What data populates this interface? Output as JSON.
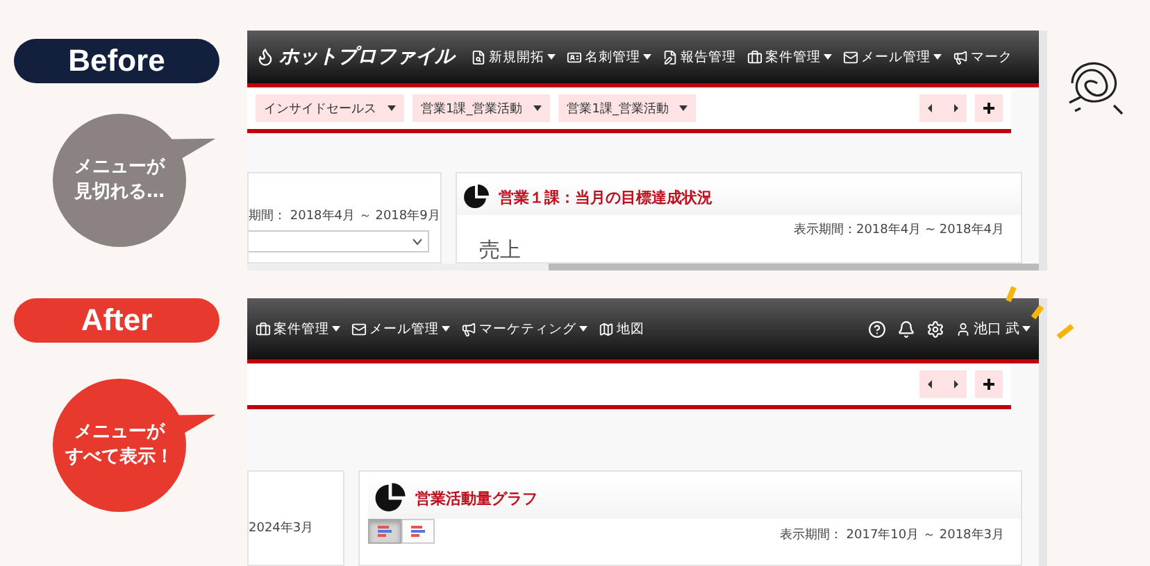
{
  "before": {
    "badge": "Before",
    "bubble": [
      "メニューが",
      "見切れる…"
    ],
    "navbar": {
      "logo": "ホットプロファイル",
      "menus": [
        {
          "label": "新規開拓",
          "dropdown": true
        },
        {
          "label": "名刺管理",
          "dropdown": true
        },
        {
          "label": "報告管理",
          "dropdown": false
        },
        {
          "label": "案件管理",
          "dropdown": true
        },
        {
          "label": "メール管理",
          "dropdown": true
        },
        {
          "label": "マーク",
          "dropdown": false
        }
      ]
    },
    "dropdown_tabs": [
      "インサイドセールス",
      "営業1課_営業活動",
      "営業1課_営業活動"
    ],
    "left_card": {
      "period": "期間： 2018年4月 ～ 2018年9月"
    },
    "right_card": {
      "title": "営業１課：当月の目標達成状況",
      "period": "表示期間：2018年4月 ~ 2018年4月",
      "heading": "売上"
    }
  },
  "after": {
    "badge": "After",
    "bubble": [
      "メニューが",
      "すべて表示！"
    ],
    "navbar": {
      "menus": [
        {
          "label": "案件管理",
          "dropdown": true
        },
        {
          "label": "メール管理",
          "dropdown": true
        },
        {
          "label": "マーケティング",
          "dropdown": true
        },
        {
          "label": "地図",
          "dropdown": false
        }
      ],
      "user": "池口 武"
    },
    "left_card": {
      "period": "2024年3月"
    },
    "right_card": {
      "title": "営業活動量グラフ",
      "period": "表示期間： 2017年10月 ～ 2018年3月",
      "chart_toggles": [
        {
          "selected": true
        },
        {
          "selected": false
        }
      ]
    }
  }
}
